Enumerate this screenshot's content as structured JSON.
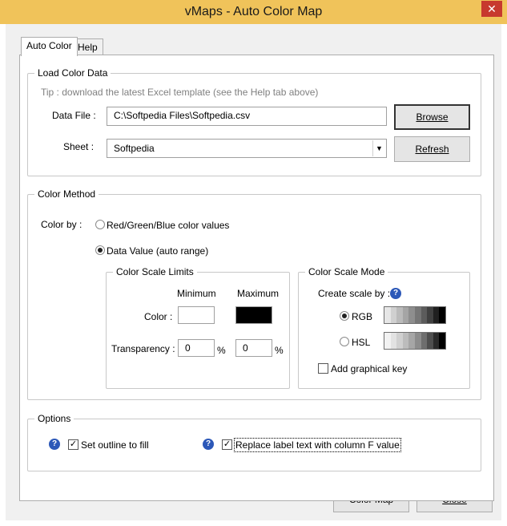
{
  "window": {
    "title": "vMaps - Auto Color Map",
    "close_glyph": "✕"
  },
  "tabs": [
    {
      "label": "Auto Color",
      "active": true
    },
    {
      "label": "Help",
      "active": false
    }
  ],
  "load": {
    "legend": "Load Color Data",
    "tip": "Tip : download the latest Excel template (see the Help tab above)",
    "data_file_label": "Data File :",
    "data_file_value": "C:\\Softpedia Files\\Softpedia.csv",
    "sheet_label": "Sheet :",
    "sheet_value": "Softpedia",
    "browse_label": "Browse",
    "refresh_label": "Refresh"
  },
  "method": {
    "legend": "Color Method",
    "color_by_label": "Color by :",
    "option_rgb": "Red/Green/Blue color values",
    "option_data": "Data Value (auto range)",
    "selected": "Data Value (auto range)"
  },
  "limits": {
    "legend": "Color Scale Limits",
    "min_header": "Minimum",
    "max_header": "Maximum",
    "color_label": "Color :",
    "min_color": "#ffffff",
    "max_color": "#000000",
    "transparency_label": "Transparency :",
    "min_transparency": "0",
    "max_transparency": "0",
    "unit": "%"
  },
  "mode": {
    "legend": "Color Scale Mode",
    "create_label": "Create scale by :",
    "rgb_label": "RGB",
    "hsl_label": "HSL",
    "selected": "RGB",
    "add_key_label": "Add graphical key",
    "add_key_checked": false
  },
  "options": {
    "legend": "Options",
    "outline_label": "Set outline to fill",
    "outline_checked": true,
    "replace_label": "Replace label text with column F value",
    "replace_checked": true
  },
  "footer": {
    "color_map_label": "Color Map",
    "close_label": "Close"
  }
}
